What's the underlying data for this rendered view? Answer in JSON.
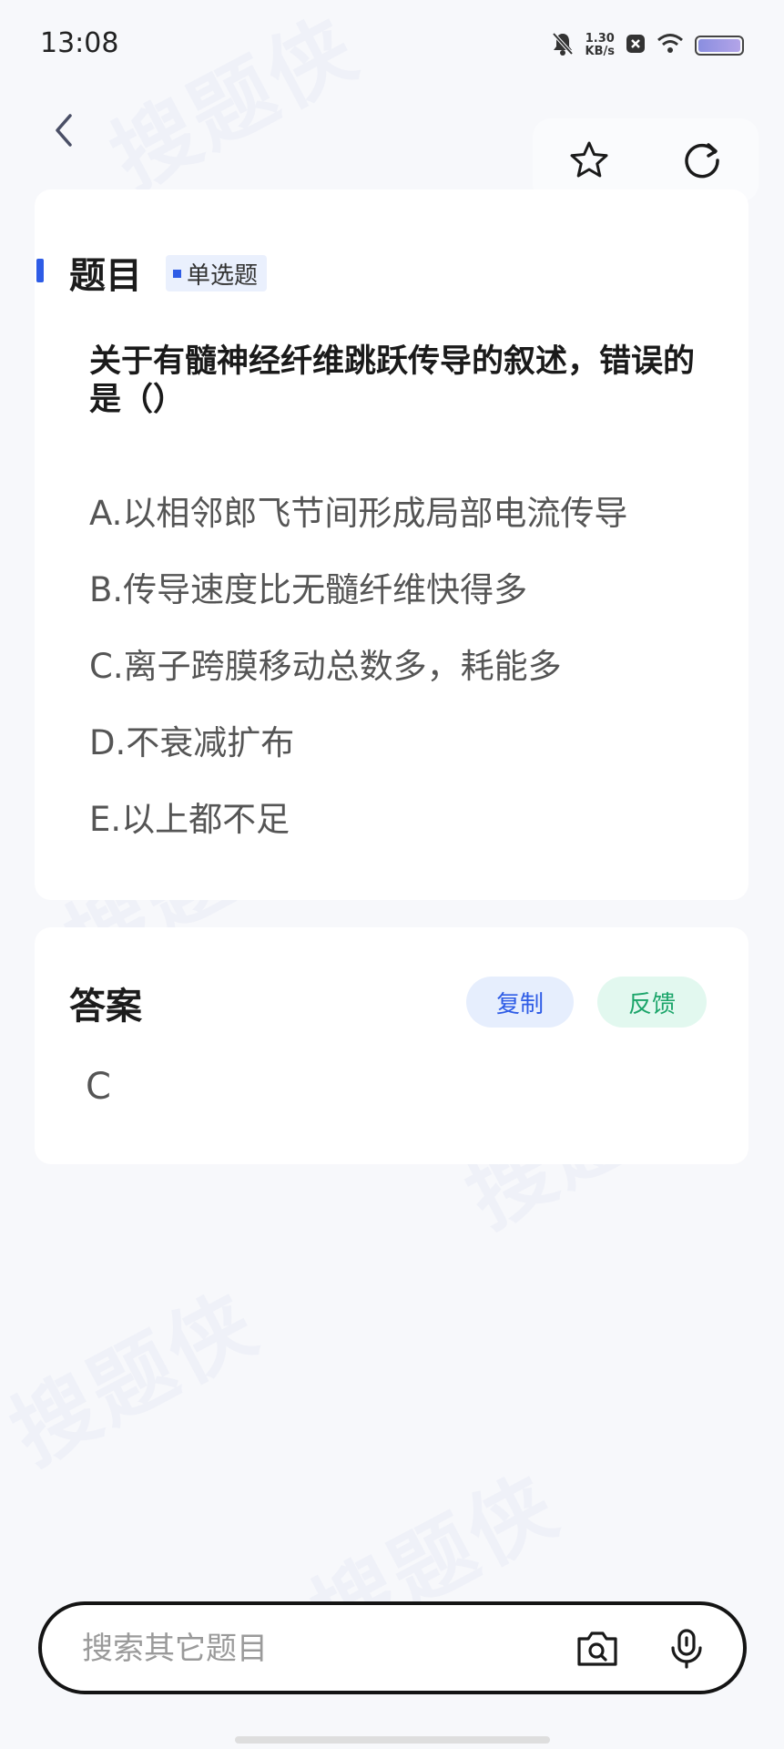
{
  "status_bar": {
    "time": "13:08",
    "net_speed_value": "1.30",
    "net_speed_unit": "KB/s",
    "icons": [
      "bell-muted-icon",
      "sim-blocked-icon",
      "wifi-icon",
      "battery-icon"
    ]
  },
  "header": {
    "back_icon": "chevron-left-icon",
    "favorite_icon": "star-icon",
    "refresh_icon": "refresh-icon"
  },
  "question": {
    "section_title": "题目",
    "type_label": "单选题",
    "text": "关于有髓神经纤维跳跃传导的叙述，错误的是（）",
    "options": [
      "A.以相邻郎飞节间形成局部电流传导",
      "B.传导速度比无髓纤维快得多",
      "C.离子跨膜移动总数多，耗能多",
      "D.不衰减扩布",
      "E.以上都不足"
    ]
  },
  "answer": {
    "section_title": "答案",
    "copy_label": "复制",
    "feedback_label": "反馈",
    "value": "C"
  },
  "search": {
    "placeholder": "搜索其它题目",
    "camera_icon": "camera-search-icon",
    "mic_icon": "microphone-icon"
  },
  "watermark": "搜题侠",
  "colors": {
    "accent_blue": "#2e5ce6",
    "accent_green": "#1ba56a",
    "background": "#f7f8fb"
  }
}
